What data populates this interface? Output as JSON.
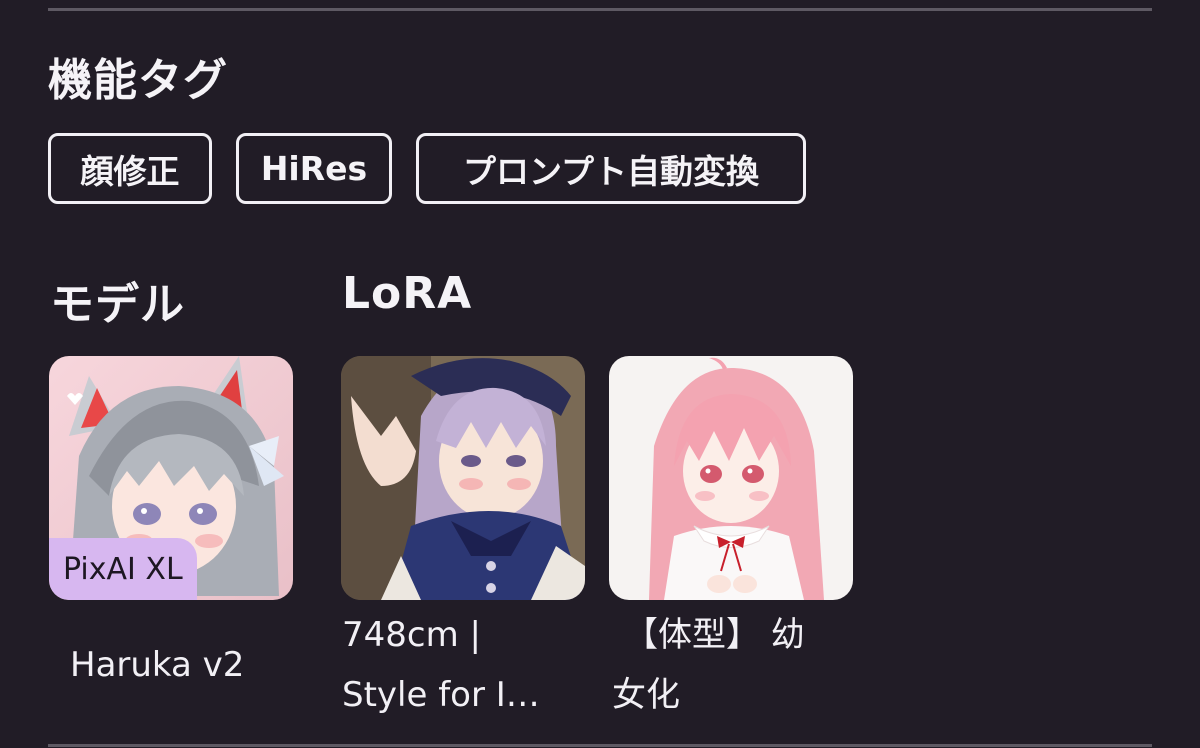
{
  "sections": {
    "feature_tags_title": "機能タグ",
    "model_title": "モデル",
    "lora_title": "LoRA"
  },
  "feature_tags": [
    {
      "label": "顔修正"
    },
    {
      "label": "HiRes"
    },
    {
      "label": "プロンプト自動変換"
    }
  ],
  "model": {
    "name": "Haruka v2",
    "badge": "PixAI XL",
    "thumbnail_icon": "anime-girl-cat-ears-thumbnail"
  },
  "loras": [
    {
      "name_line1": "748cm |",
      "name_line2": "Style for I…",
      "thumbnail_icon": "anime-girl-maid-peace-sign-thumbnail"
    },
    {
      "name_line1": "【体型】 幼",
      "name_line2": "女化",
      "thumbnail_icon": "anime-girl-pink-hair-thumbnail"
    }
  ],
  "colors": {
    "background": "#211c26",
    "badge_bg": "#d7b7f0",
    "text": "#f2f0f5",
    "divider": "#5e5963"
  }
}
